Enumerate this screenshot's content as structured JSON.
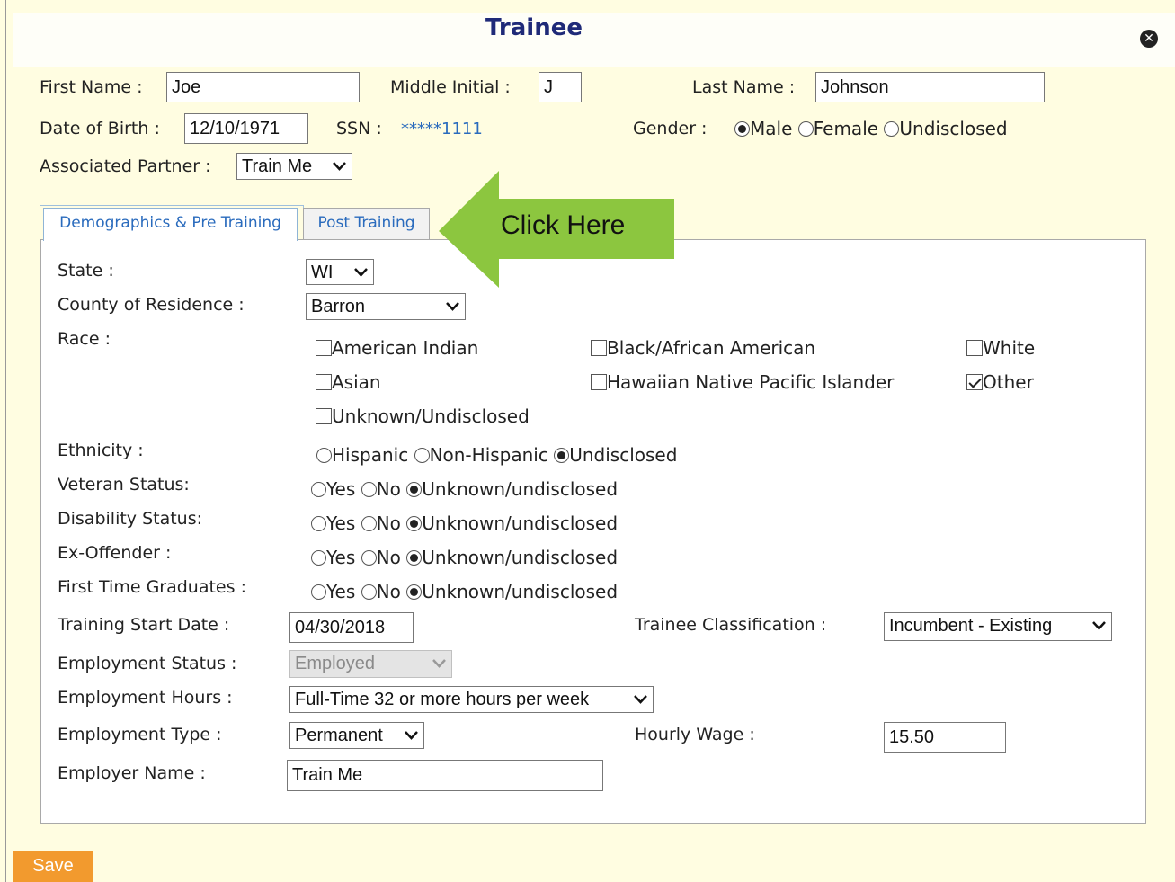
{
  "title": "Trainee",
  "header": {
    "first_name_label": "First Name :",
    "first_name_value": "Joe",
    "middle_initial_label": "Middle Initial :",
    "middle_initial_value": "J",
    "last_name_label": "Last Name :",
    "last_name_value": "Johnson",
    "dob_label": "Date of Birth :",
    "dob_value": "12/10/1971",
    "ssn_label": "SSN :",
    "ssn_value": "*****1111",
    "gender_label": "Gender :",
    "gender_options": [
      "Male",
      "Female",
      "Undisclosed"
    ],
    "gender_selected": "Male",
    "partner_label": "Associated Partner :",
    "partner_value": "Train Me"
  },
  "tabs": [
    {
      "label": "Demographics & Pre Training",
      "active": true
    },
    {
      "label": "Post Training",
      "active": false
    }
  ],
  "callout": {
    "text": "Click Here",
    "color": "#8cc63f"
  },
  "form": {
    "state_label": "State :",
    "state_value": "WI",
    "county_label": "County of Residence :",
    "county_value": "Barron",
    "race_label": "Race :",
    "race_options": [
      {
        "label": "American Indian",
        "checked": false
      },
      {
        "label": "Black/African American",
        "checked": false
      },
      {
        "label": "White",
        "checked": false
      },
      {
        "label": "Asian",
        "checked": false
      },
      {
        "label": "Hawaiian Native Pacific Islander",
        "checked": false
      },
      {
        "label": "Other",
        "checked": true
      },
      {
        "label": "Unknown/Undisclosed",
        "checked": false
      }
    ],
    "ethnicity_label": "Ethnicity :",
    "ethnicity_options": [
      "Hispanic",
      "Non-Hispanic",
      "Undisclosed"
    ],
    "ethnicity_selected": "Undisclosed",
    "veteran_label": "Veteran Status:",
    "disability_label": "Disability Status:",
    "exoffender_label": "Ex-Offender :",
    "firsttime_label": "First Time Graduates :",
    "ynu_options": [
      "Yes",
      "No",
      "Unknown/undisclosed"
    ],
    "ynu_selected": "Unknown/undisclosed",
    "start_date_label": "Training Start Date :",
    "start_date_value": "04/30/2018",
    "classification_label": "Trainee Classification :",
    "classification_value": "Incumbent - Existing",
    "emp_status_label": "Employment Status :",
    "emp_status_value": "Employed",
    "emp_hours_label": "Employment Hours :",
    "emp_hours_value": "Full-Time 32 or more hours per week",
    "emp_type_label": "Employment Type :",
    "emp_type_value": "Permanent",
    "wage_label": "Hourly Wage :",
    "wage_value": "15.50",
    "employer_label": "Employer Name :",
    "employer_value": "Train Me"
  },
  "save_label": "Save",
  "colors": {
    "accent": "#1f2a78",
    "link": "#2a6bbd",
    "save": "#f29a2e",
    "background": "#fffde1"
  }
}
